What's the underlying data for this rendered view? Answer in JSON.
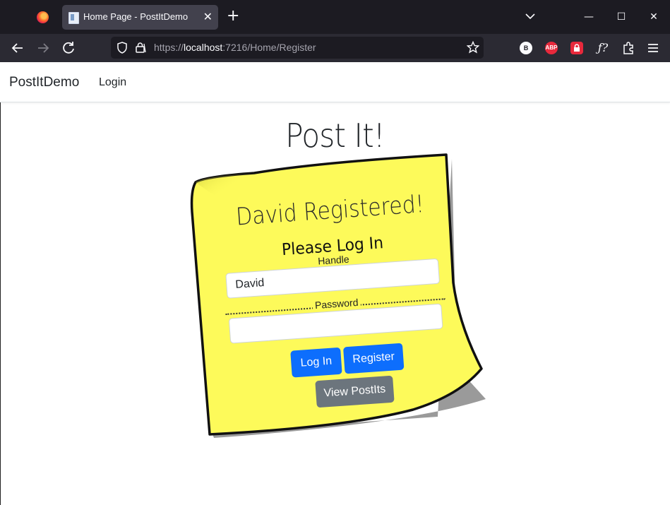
{
  "browser": {
    "tab_title": "Home Page - PostItDemo",
    "tab_close": "✕",
    "new_tab": "+",
    "url_scheme": "https://",
    "url_host": "localhost",
    "url_rest": ":7216/Home/Register",
    "extensions": [
      {
        "name": "b-extension",
        "label": "B",
        "color": "#ffffff"
      },
      {
        "name": "adblock-plus",
        "label": "ABP",
        "color": "#e8293c"
      },
      {
        "name": "lock-extension",
        "label": "",
        "color": "#e8293c"
      }
    ],
    "window_controls": [
      "—",
      "☐",
      "✕"
    ]
  },
  "site": {
    "brand": "PostItDemo",
    "nav_login": "Login",
    "page_title": "Post It!"
  },
  "note": {
    "registered": "David Registered!",
    "please_log_in": "Please Log In",
    "handle_label": "Handle",
    "handle_value": "David",
    "password_label": "Password",
    "password_value": "",
    "login_button": "Log In",
    "register_button": "Register",
    "view_button": "View PostIts",
    "colors": {
      "paper": "#fdfa5a",
      "primary": "#0d6efd",
      "secondary": "#6c757d"
    }
  }
}
